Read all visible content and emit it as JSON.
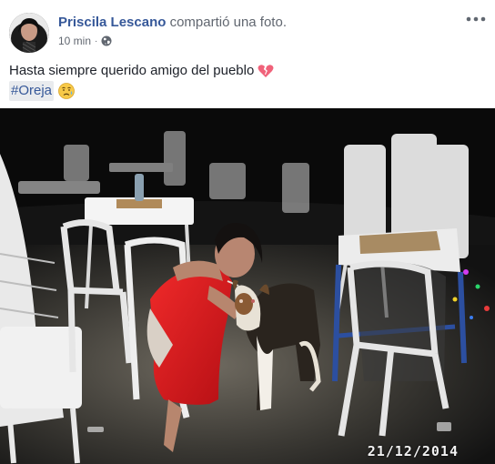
{
  "post": {
    "author": "Priscila Lescano",
    "action": "compartió una foto.",
    "time": "10 min",
    "privacy_icon": "globe-icon",
    "more_icon": "more-horizontal-icon",
    "caption_text": "Hasta siempre querido amigo del pueblo",
    "caption_emoji": "broken-heart-icon",
    "hashtag": "#Oreja",
    "hashtag_emoji": "disappointed-relieved-face-icon",
    "photo_date": "21/12/2014"
  },
  "colors": {
    "author": "#365899",
    "meta": "#616770",
    "hashtag_bg": "#e9ebee",
    "broken_heart": "#f0627a"
  }
}
